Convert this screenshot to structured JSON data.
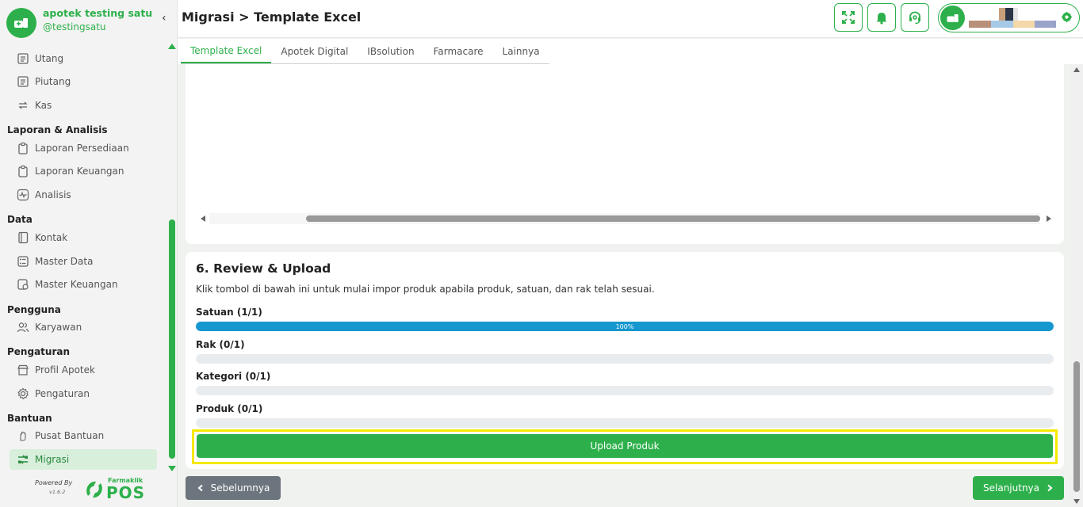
{
  "app": {
    "store_name": "apotek testing satu",
    "username": "@testingsatu",
    "collapse_icon": "‹"
  },
  "colors": {
    "primary": "#2db04b",
    "progress": "#1597cf",
    "highlight": "#f5e900",
    "secondary_button": "#6c757d"
  },
  "sidebar": {
    "items_top": [
      {
        "label": "Utang",
        "icon": "ledger-icon"
      },
      {
        "label": "Piutang",
        "icon": "ledger-icon"
      },
      {
        "label": "Kas",
        "icon": "cash-transfer-icon"
      }
    ],
    "laporan": {
      "title": "Laporan & Analisis",
      "items": [
        {
          "label": "Laporan Persediaan",
          "icon": "clipboard-icon"
        },
        {
          "label": "Laporan Keuangan",
          "icon": "clipboard-icon"
        },
        {
          "label": "Analisis",
          "icon": "activity-icon"
        }
      ]
    },
    "data": {
      "title": "Data",
      "items": [
        {
          "label": "Kontak",
          "icon": "contact-book-icon"
        },
        {
          "label": "Master Data",
          "icon": "database-icon"
        },
        {
          "label": "Master Keuangan",
          "icon": "finance-icon"
        }
      ]
    },
    "pengguna": {
      "title": "Pengguna",
      "items": [
        {
          "label": "Karyawan",
          "icon": "users-icon"
        }
      ]
    },
    "pengaturan": {
      "title": "Pengaturan",
      "items": [
        {
          "label": "Profil Apotek",
          "icon": "store-icon"
        },
        {
          "label": "Pengaturan",
          "icon": "gear-icon"
        }
      ]
    },
    "bantuan": {
      "title": "Bantuan",
      "items": [
        {
          "label": "Pusat Bantuan",
          "icon": "hand-help-icon"
        },
        {
          "label": "Migrasi",
          "icon": "migrate-icon",
          "active": true
        }
      ]
    },
    "powered_by": "Powered By",
    "version": "v1.6.2",
    "brand_small": "Farmaklik",
    "brand_big": "POS"
  },
  "header": {
    "title": "Migrasi > Template Excel",
    "buttons": [
      "fullscreen-icon",
      "bell-icon",
      "headset-icon"
    ]
  },
  "tabs": [
    {
      "label": "Template Excel",
      "active": true
    },
    {
      "label": "Apotek Digital",
      "active": false
    },
    {
      "label": "IBsolution",
      "active": false
    },
    {
      "label": "Farmacare",
      "active": false
    },
    {
      "label": "Lainnya",
      "active": false
    }
  ],
  "review": {
    "title": "6. Review & Upload",
    "description": "Klik tombol di bawah ini untuk mulai impor produk apabila produk, satuan, dan rak telah sesuai.",
    "progress": [
      {
        "label": "Satuan (1/1)",
        "percent": 100,
        "text": "100%"
      },
      {
        "label": "Rak (0/1)",
        "percent": 0,
        "text": ""
      },
      {
        "label": "Kategori (0/1)",
        "percent": 0,
        "text": ""
      },
      {
        "label": "Produk (0/1)",
        "percent": 0,
        "text": ""
      }
    ],
    "upload_button": "Upload Produk"
  },
  "footer": {
    "prev": "Sebelumnya",
    "next": "Selanjutnya"
  }
}
